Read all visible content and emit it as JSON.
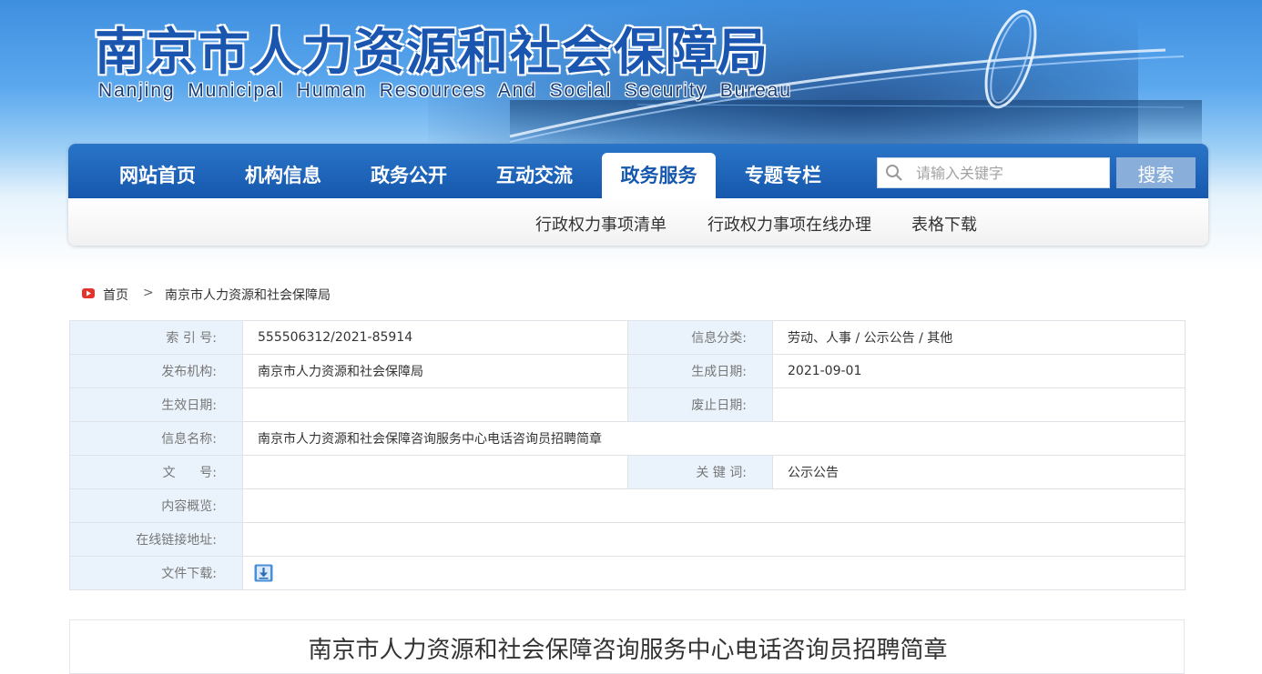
{
  "header": {
    "title_cn": "南京市人力资源和社会保障局",
    "title_en": "Nanjing Municipal Human Resources And Social Security Bureau"
  },
  "nav": {
    "items": [
      {
        "label": "网站首页",
        "active": false
      },
      {
        "label": "机构信息",
        "active": false
      },
      {
        "label": "政务公开",
        "active": false
      },
      {
        "label": "互动交流",
        "active": false
      },
      {
        "label": "政务服务",
        "active": true
      },
      {
        "label": "专题专栏",
        "active": false
      }
    ],
    "search_placeholder": "请输入关键字",
    "search_button": "搜索",
    "search_icon": "search-icon"
  },
  "subnav": {
    "items": [
      "行政权力事项清单",
      "行政权力事项在线办理",
      "表格下载"
    ]
  },
  "breadcrumb": {
    "home": "首页",
    "separator": ">",
    "current": "南京市人力资源和社会保障局"
  },
  "info": {
    "index_label": "索 引 号:",
    "index_value": "555506312/2021-85914",
    "category_label": "信息分类:",
    "category_value": "劳动、人事 / 公示公告 / 其他",
    "publisher_label": "发布机构:",
    "publisher_value": "南京市人力资源和社会保障局",
    "created_label": "生成日期:",
    "created_value": "2021-09-01",
    "effective_label": "生效日期:",
    "effective_value": "",
    "abolish_label": "废止日期:",
    "abolish_value": "",
    "name_label": "信息名称:",
    "name_value": "南京市人力资源和社会保障咨询服务中心电话咨询员招聘简章",
    "doc_no_label": "文      号:",
    "doc_no_value": "",
    "keywords_label": "关 键 词:",
    "keywords_value": "公示公告",
    "summary_label": "内容概览:",
    "summary_value": "",
    "link_label": "在线链接地址:",
    "link_value": "",
    "download_label": "文件下载:"
  },
  "article": {
    "title": "南京市人力资源和社会保障咨询服务中心电话咨询员招聘简章"
  },
  "colors": {
    "nav_blue": "#1658ad",
    "label_bg": "#eaf3fc",
    "search_button_bg": "#89aed9",
    "title_blue": "#1a56b0"
  }
}
